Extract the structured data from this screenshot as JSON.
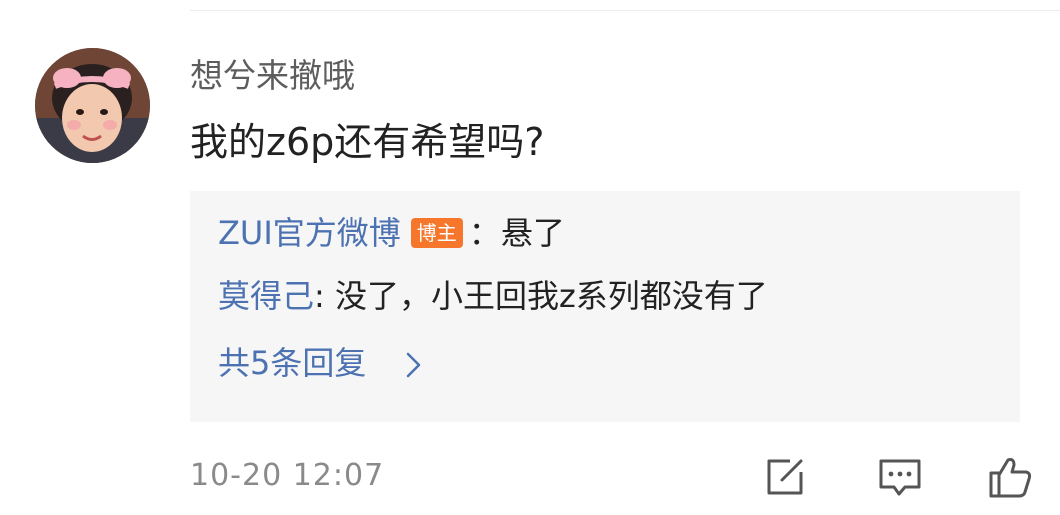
{
  "comment": {
    "username": "想兮来撤哦",
    "text": "我的z6p还有希望吗?"
  },
  "replies": [
    {
      "author": "ZUI官方微博",
      "badge": "博主",
      "separator": "：",
      "content": "悬了"
    },
    {
      "author": "莫得己",
      "separator": ": ",
      "content": "没了，小王回我z系列都没有了"
    }
  ],
  "more_replies_label": "共5条回复",
  "timestamp": "10-20  12:07",
  "actions": {
    "repost_icon": "repost-icon",
    "comment_icon": "comment-icon",
    "like_icon": "thumbs-up-icon"
  },
  "colors": {
    "link_blue": "#4c72b2",
    "badge_orange": "#f6762b",
    "reply_bg": "#f6f6f6",
    "text_dark": "#222222",
    "text_gray": "#8a8a8a"
  }
}
